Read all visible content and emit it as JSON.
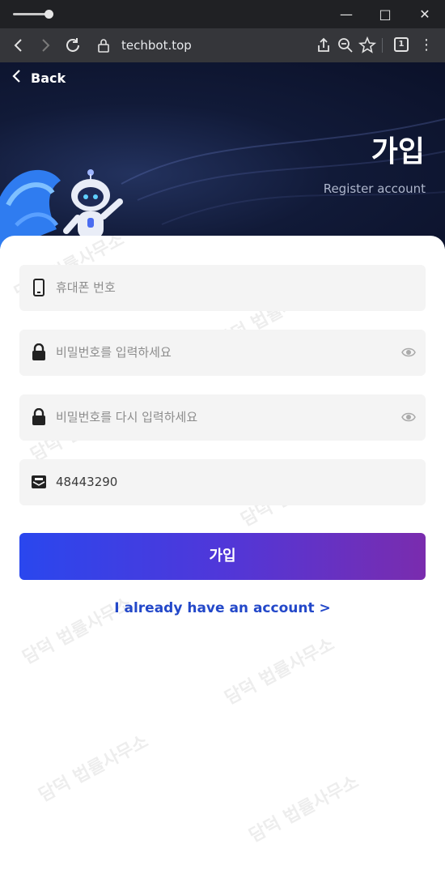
{
  "browser": {
    "url": "techbot.top",
    "tab_count": "1"
  },
  "header": {
    "back_label": "Back",
    "title": "가입",
    "subtitle": "Register account"
  },
  "form": {
    "phone_placeholder": "휴대폰 번호",
    "password_placeholder": "비밀번호를 입력하세요",
    "password_confirm_placeholder": "비밀번호를 다시 입력하세요",
    "invite_code_value": "48443290",
    "submit_label": "가입",
    "login_link": "I already have an account >"
  },
  "watermark_text": "담덕 법률사무소",
  "colors": {
    "button_start": "#2a47ee",
    "button_end": "#7a2cae",
    "link": "#2348c9",
    "hero_bg": "#111a38"
  },
  "icons": {
    "phone": "phone-icon",
    "password": "lock-icon",
    "password_confirm": "lock-icon",
    "invite": "envelope-icon",
    "visibility": "eye-icon"
  }
}
